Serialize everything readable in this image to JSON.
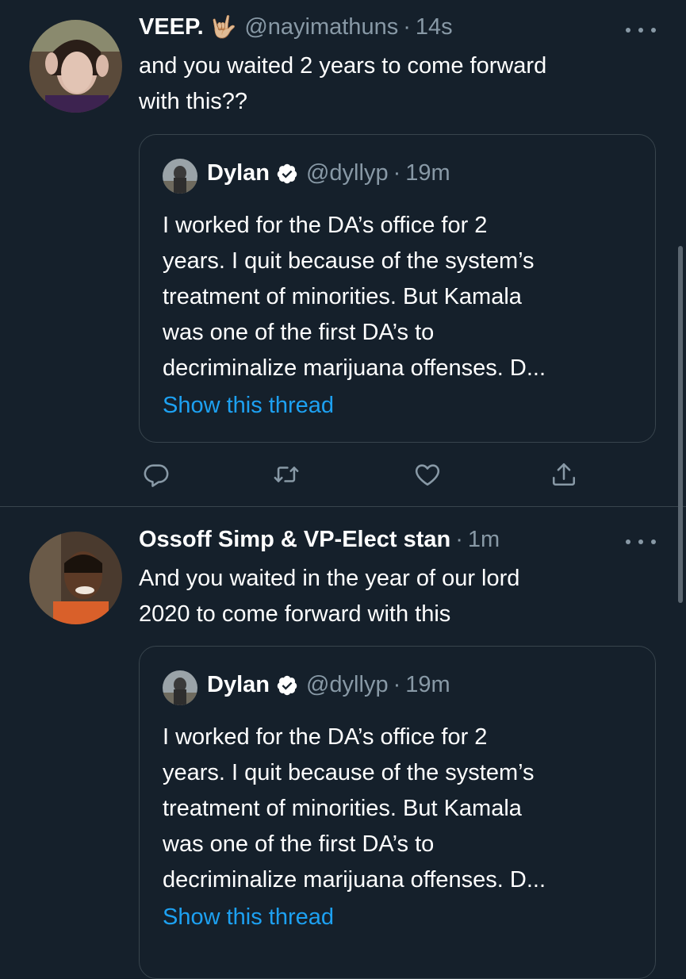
{
  "tweets": [
    {
      "display_name": "VEEP.",
      "emoji": "🤟🏼",
      "handle": "@nayimathuns",
      "separator": "·",
      "time": "14s",
      "text_lines": [
        "and you waited 2 years to come forward",
        "with this??"
      ],
      "quote": {
        "name": "Dylan",
        "handle": "@dyllyp",
        "separator": "·",
        "time": "19m",
        "text_lines": [
          "I worked for the DA’s office for 2",
          "years. I quit because of the system’s",
          "treatment of minorities. But Kamala",
          "was one of the first DA’s to",
          "decriminalize marijuana offenses. D..."
        ],
        "show_thread": "Show this thread"
      }
    },
    {
      "display_name": "Ossoff Simp & VP-Elect stan",
      "handle": "",
      "separator": "·",
      "time": "1m",
      "text_lines": [
        "And you waited in the year of our lord",
        "2020 to come forward with this"
      ],
      "quote": {
        "name": "Dylan",
        "handle": "@dyllyp",
        "separator": "·",
        "time": "19m",
        "text_lines": [
          "I worked for the DA’s office for 2",
          "years. I quit because of the system’s",
          "treatment of minorities. But Kamala",
          "was one of the first DA’s to",
          "decriminalize marijuana offenses. D..."
        ],
        "show_thread": "Show this thread"
      }
    }
  ],
  "icons": {
    "reply": "reply-icon",
    "retweet": "retweet-icon",
    "like": "heart-icon",
    "share": "share-icon",
    "verified": "verified-badge-icon",
    "more": "more-icon"
  },
  "colors": {
    "background": "#15202b",
    "divider": "#38444d",
    "text_primary": "#ffffff",
    "text_secondary": "#8899a6",
    "link": "#1da1f2",
    "verified": "#ffffff"
  }
}
